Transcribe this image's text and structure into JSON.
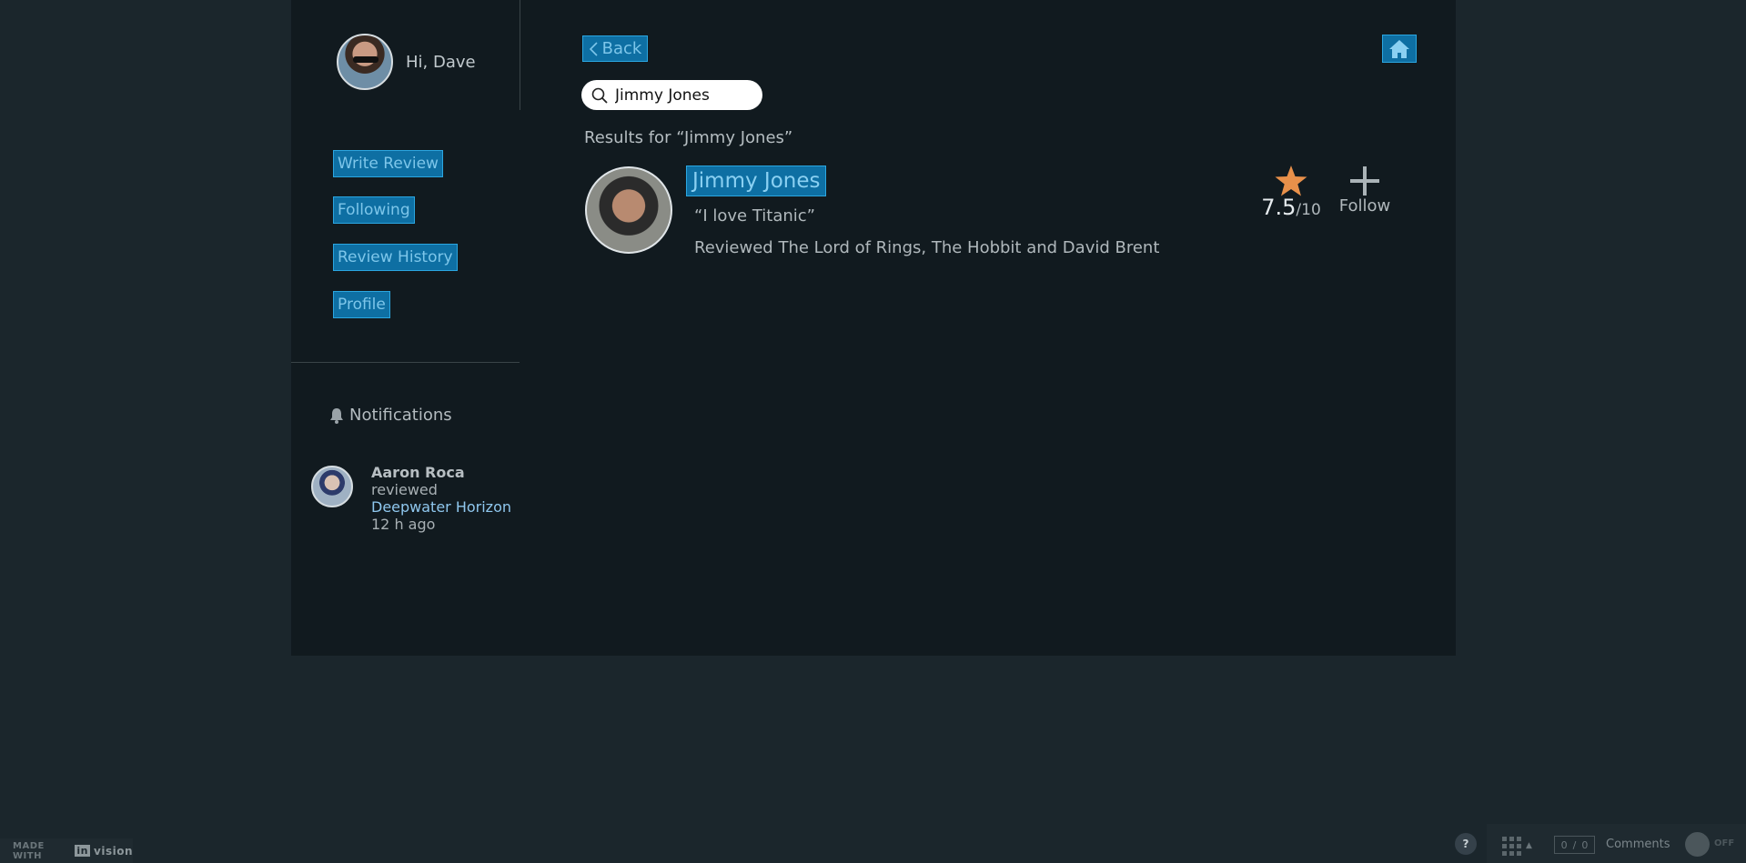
{
  "sidebar": {
    "greeting": "Hi, Dave",
    "nav": [
      {
        "label": "Write Review"
      },
      {
        "label": "Following"
      },
      {
        "label": "Review History"
      },
      {
        "label": "Profile"
      }
    ],
    "notifications_title": "Notifications",
    "notification": {
      "name": "Aaron Roca",
      "action": "reviewed",
      "target": "Deepwater Horizon",
      "time": "12 h ago"
    }
  },
  "header": {
    "back_label": "Back"
  },
  "search": {
    "value": "Jimmy Jones"
  },
  "results": {
    "heading": "Results for “Jimmy Jones”",
    "items": [
      {
        "name": "Jimmy Jones",
        "quote": "“I love Titanic”",
        "reviewed": "Reviewed The Lord of Rings, The Hobbit and David Brent",
        "rating": "7.5",
        "rating_denominator": "/10",
        "follow_label": "Follow"
      }
    ]
  },
  "footer": {
    "made_with": "MADE WITH",
    "brand_in": "in",
    "brand_vision": "vision",
    "help": "?",
    "counter_left": "0",
    "counter_right": "0",
    "comments_label": "Comments",
    "toggle_label": "OFF"
  },
  "colors": {
    "accent": "#0e6fa3",
    "star": "#e8904a",
    "page_bg": "#1b262c",
    "panel_bg": "#111a1f"
  }
}
